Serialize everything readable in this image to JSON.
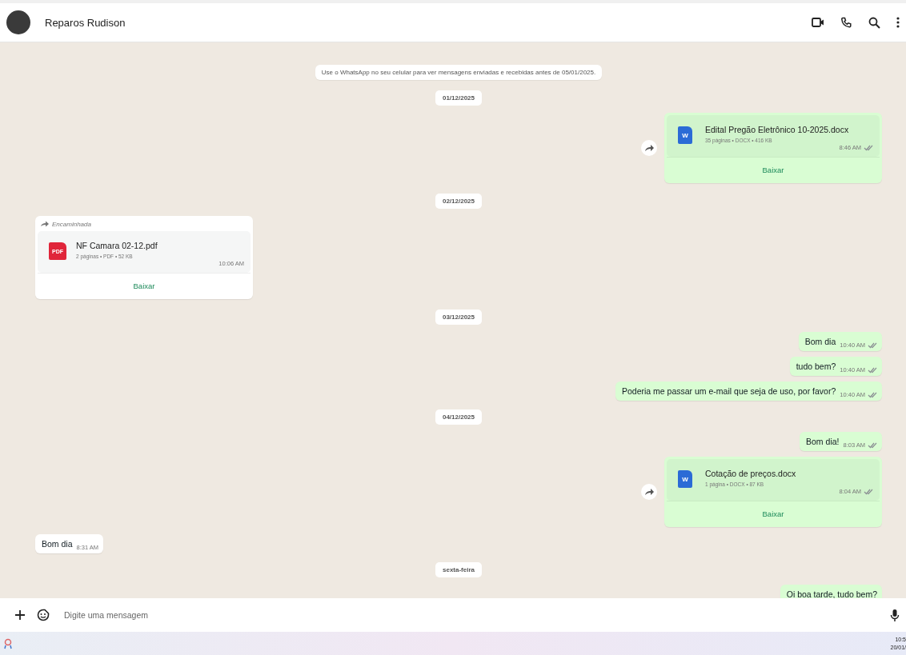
{
  "header": {
    "contact_name": "Reparos Rudison"
  },
  "chat": [
    {
      "kind": "notice",
      "text": "Use o WhatsApp no seu celular para ver mensagens enviadas e recebidas antes de 05/01/2025."
    },
    {
      "kind": "date",
      "text": "01/12/2025"
    },
    {
      "kind": "docx",
      "outgoing": true,
      "icon_label": "W",
      "file_name": "Edital Pregão Eletrônico 10-2025.docx",
      "details": "35 páginas • DOCX • 416 KB",
      "time": "8:46 AM",
      "delivered": true,
      "action": "Baixar",
      "forward_button": true
    },
    {
      "kind": "date",
      "text": "02/12/2025"
    },
    {
      "kind": "pdf",
      "outgoing": false,
      "forwarded_label": "Encaminhada",
      "icon_label": "PDF",
      "file_name": "NF Camara 02-12.pdf",
      "details": "2 páginas • PDF • 52 KB",
      "time": "10:06 AM",
      "action": "Baixar"
    },
    {
      "kind": "date",
      "text": "03/12/2025"
    },
    {
      "kind": "text",
      "outgoing": true,
      "text": "Bom dia",
      "time": "10:40 AM",
      "delivered": true
    },
    {
      "kind": "text",
      "outgoing": true,
      "text": "tudo bem?",
      "time": "10:40 AM",
      "delivered": true
    },
    {
      "kind": "text",
      "outgoing": true,
      "text": "Poderia me passar um e-mail que seja de uso, por favor?",
      "time": "10:40 AM",
      "delivered": true
    },
    {
      "kind": "date",
      "text": "04/12/2025"
    },
    {
      "kind": "text",
      "outgoing": true,
      "text": "Bom dia!",
      "time": "8:03 AM",
      "delivered": true
    },
    {
      "kind": "docx",
      "outgoing": true,
      "icon_label": "W",
      "file_name": "Cotação de preços.docx",
      "details": "1 página • DOCX • 87 KB",
      "time": "8:04 AM",
      "delivered": true,
      "action": "Baixar",
      "forward_button": true
    },
    {
      "kind": "text",
      "outgoing": false,
      "text": "Bom dia",
      "time": "8:31 AM"
    },
    {
      "kind": "date",
      "text": "sexta-feira"
    },
    {
      "kind": "text",
      "outgoing": true,
      "text": "Oi boa tarde, tudo bem?"
    }
  ],
  "composer": {
    "placeholder": "Digite uma mensagem"
  },
  "taskbar": {
    "time": "10:5",
    "date": "20/01/"
  }
}
